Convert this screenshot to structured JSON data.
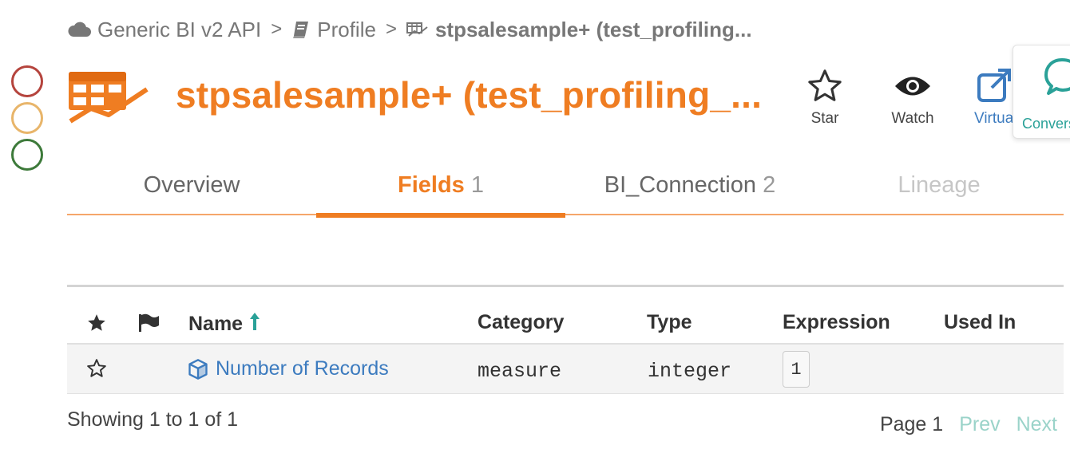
{
  "breadcrumb": {
    "items": [
      {
        "label": "Generic BI v2 API",
        "icon": "cloud-icon"
      },
      {
        "label": "Profile",
        "icon": "book-icon"
      },
      {
        "label": "stpsalesample+ (test_profiling...",
        "icon": "table-chart-icon"
      }
    ],
    "separator": ">"
  },
  "header": {
    "title": "stpsalesample+ (test_profiling_...",
    "accent_color": "#ef7d22"
  },
  "actions": {
    "star_label": "Star",
    "watch_label": "Watch",
    "virtual_label": "Virtual",
    "conversation_label": "Conversation"
  },
  "tabs": [
    {
      "label": "Overview",
      "count": ""
    },
    {
      "label": "Fields",
      "count": "1"
    },
    {
      "label": "BI_Connection",
      "count": "2"
    },
    {
      "label": "Lineage",
      "count": ""
    }
  ],
  "table": {
    "headers": {
      "name": "Name",
      "category": "Category",
      "type": "Type",
      "expression": "Expression",
      "used_in": "Used In"
    },
    "rows": [
      {
        "name": "Number of Records",
        "category": "measure",
        "type": "integer",
        "expression": "1",
        "used_in": ""
      }
    ]
  },
  "footer": {
    "showing": "Showing 1 to 1 of 1",
    "page": "Page 1",
    "prev": "Prev",
    "next": "Next"
  }
}
